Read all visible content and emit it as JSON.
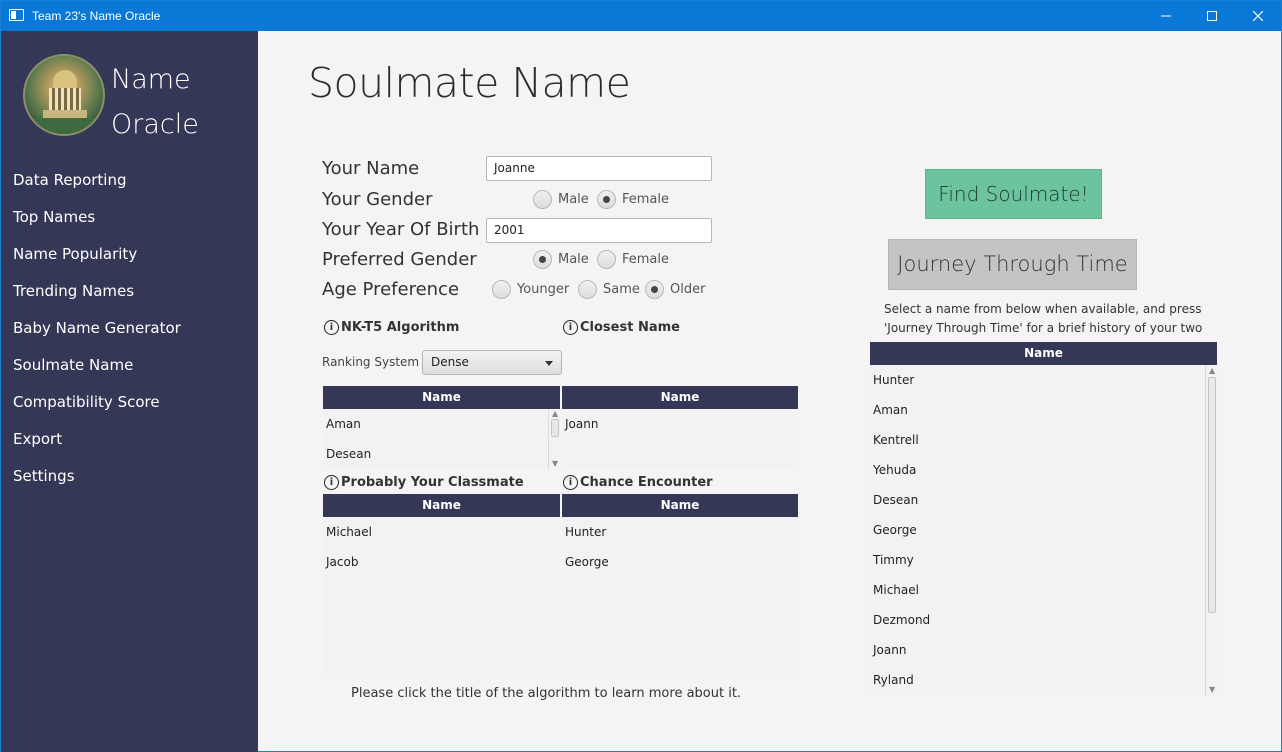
{
  "window": {
    "title": "Team 23's Name Oracle"
  },
  "sidebar": {
    "app_name_line1": "Name",
    "app_name_line2": "Oracle",
    "items": [
      {
        "label": "Data Reporting"
      },
      {
        "label": "Top Names"
      },
      {
        "label": "Name Popularity"
      },
      {
        "label": "Trending Names"
      },
      {
        "label": "Baby Name Generator"
      },
      {
        "label": "Soulmate Name"
      },
      {
        "label": "Compatibility Score"
      },
      {
        "label": "Export"
      },
      {
        "label": "Settings"
      }
    ]
  },
  "page": {
    "title": "Soulmate Name"
  },
  "form": {
    "your_name_label": "Your Name",
    "your_name_value": "Joanne",
    "your_gender_label": "Your Gender",
    "your_gender_options": [
      "Male",
      "Female"
    ],
    "your_gender_selected": "Female",
    "year_label": "Your Year Of Birth",
    "year_value": "2001",
    "pref_gender_label": "Preferred Gender",
    "pref_gender_options": [
      "Male",
      "Female"
    ],
    "pref_gender_selected": "Male",
    "age_pref_label": "Age Preference",
    "age_pref_options": [
      "Younger",
      "Same",
      "Older"
    ],
    "age_pref_selected": "Older"
  },
  "algorithms": {
    "nkt5": {
      "title": "NK-T5 Algorithm",
      "column": "Name",
      "rows": [
        "Aman",
        "Desean"
      ]
    },
    "closest": {
      "title": "Closest Name",
      "column": "Name",
      "rows": [
        "Joann"
      ]
    },
    "classmate": {
      "title": "Probably Your Classmate",
      "column": "Name",
      "rows": [
        "Michael",
        "Jacob"
      ]
    },
    "chance": {
      "title": "Chance Encounter",
      "column": "Name",
      "rows": [
        "Hunter",
        "George"
      ]
    },
    "ranking_label": "Ranking System",
    "ranking_value": "Dense",
    "footer_note": "Please click the title of the algorithm to learn more about it."
  },
  "actions": {
    "find_label": "Find Soulmate!",
    "journey_label": "Journey Through Time",
    "help_text": "Select a name from below when available, and press 'Journey Through Time' for a brief history of your two names."
  },
  "results": {
    "column": "Name",
    "rows": [
      "Hunter",
      "Aman",
      "Kentrell",
      "Yehuda",
      "Desean",
      "George",
      "Timmy",
      "Michael",
      "Dezmond",
      "Joann",
      "Ryland"
    ]
  },
  "icons": {
    "info": "info-icon",
    "app": "app-icon",
    "logo": "logo-image"
  },
  "colors": {
    "titlebar": "#0a78d7",
    "sidebar": "#343856",
    "table_header": "#343856",
    "find_button": "#6cc49f",
    "journey_button": "#c4c4c4"
  }
}
